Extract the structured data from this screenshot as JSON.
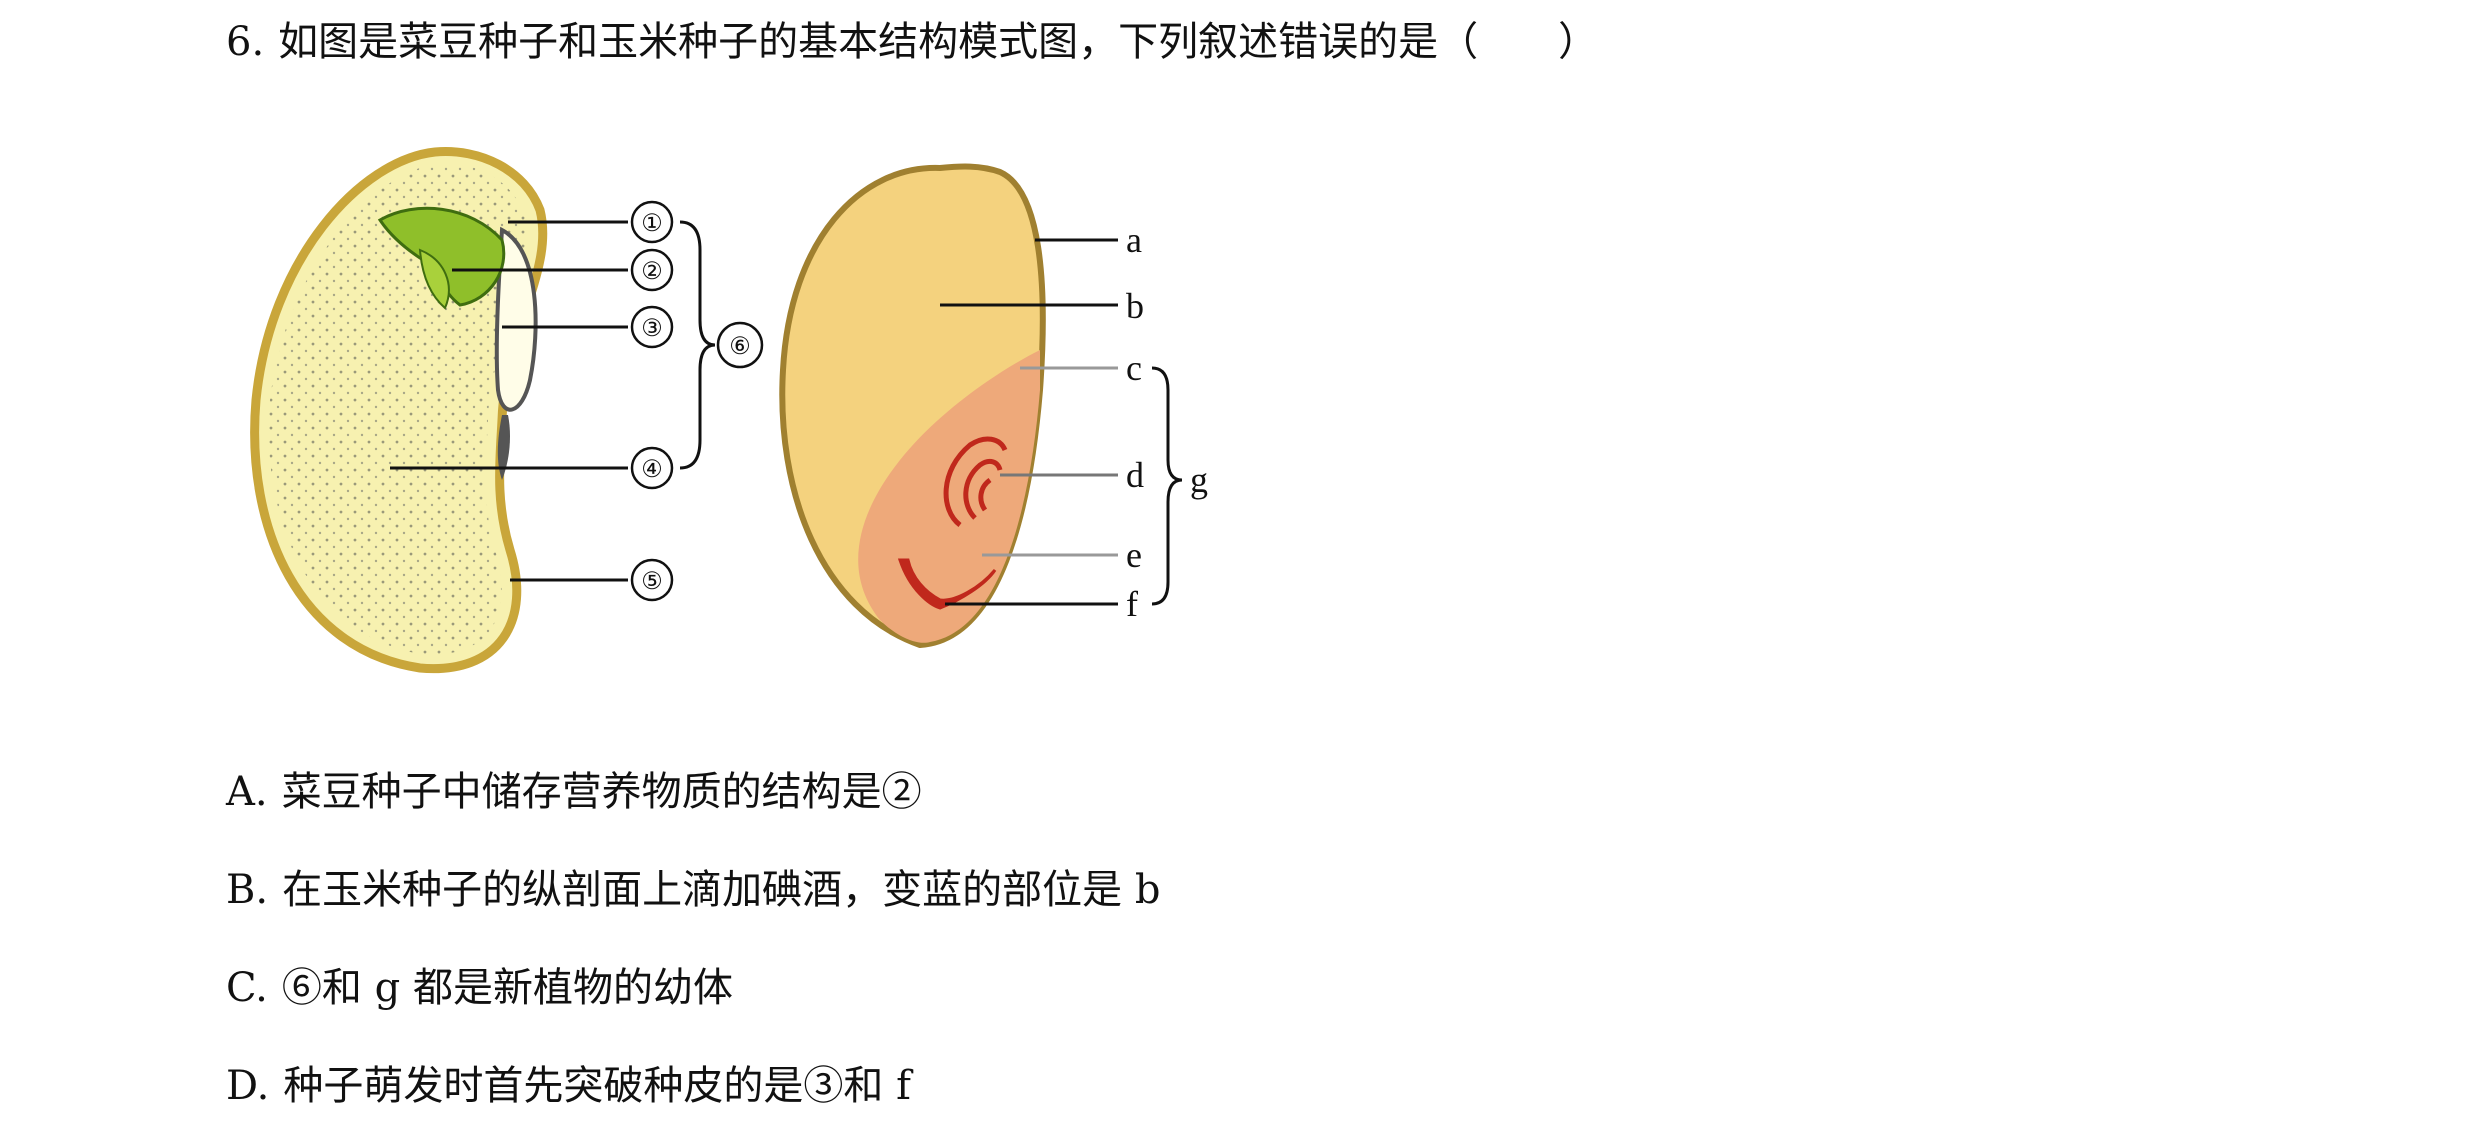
{
  "question": {
    "number": "6.",
    "text": "如图是菜豆种子和玉米种子的基本结构模式图，下列叙述错误的是（　　）"
  },
  "figure": {
    "bean_labels": [
      "①",
      "②",
      "③",
      "④",
      "⑤",
      "⑥"
    ],
    "corn_labels": [
      "a",
      "b",
      "c",
      "d",
      "e",
      "f",
      "g"
    ],
    "colors": {
      "bean_fill": "#f7f1b0",
      "bean_outline": "#c9a63a",
      "embryo_green": "#8fbf2a",
      "corn_endosperm": "#f4d27e",
      "corn_embryo": "#eea97a",
      "corn_red": "#c0281c"
    }
  },
  "options": [
    {
      "letter": "A.",
      "text": "菜豆种子中储存营养物质的结构是②"
    },
    {
      "letter": "B.",
      "text": "在玉米种子的纵剖面上滴加碘酒，变蓝的部位是 b"
    },
    {
      "letter": "C.",
      "text": "⑥和 g 都是新植物的幼体"
    },
    {
      "letter": "D.",
      "text": "种子萌发时首先突破种皮的是③和 f"
    }
  ]
}
